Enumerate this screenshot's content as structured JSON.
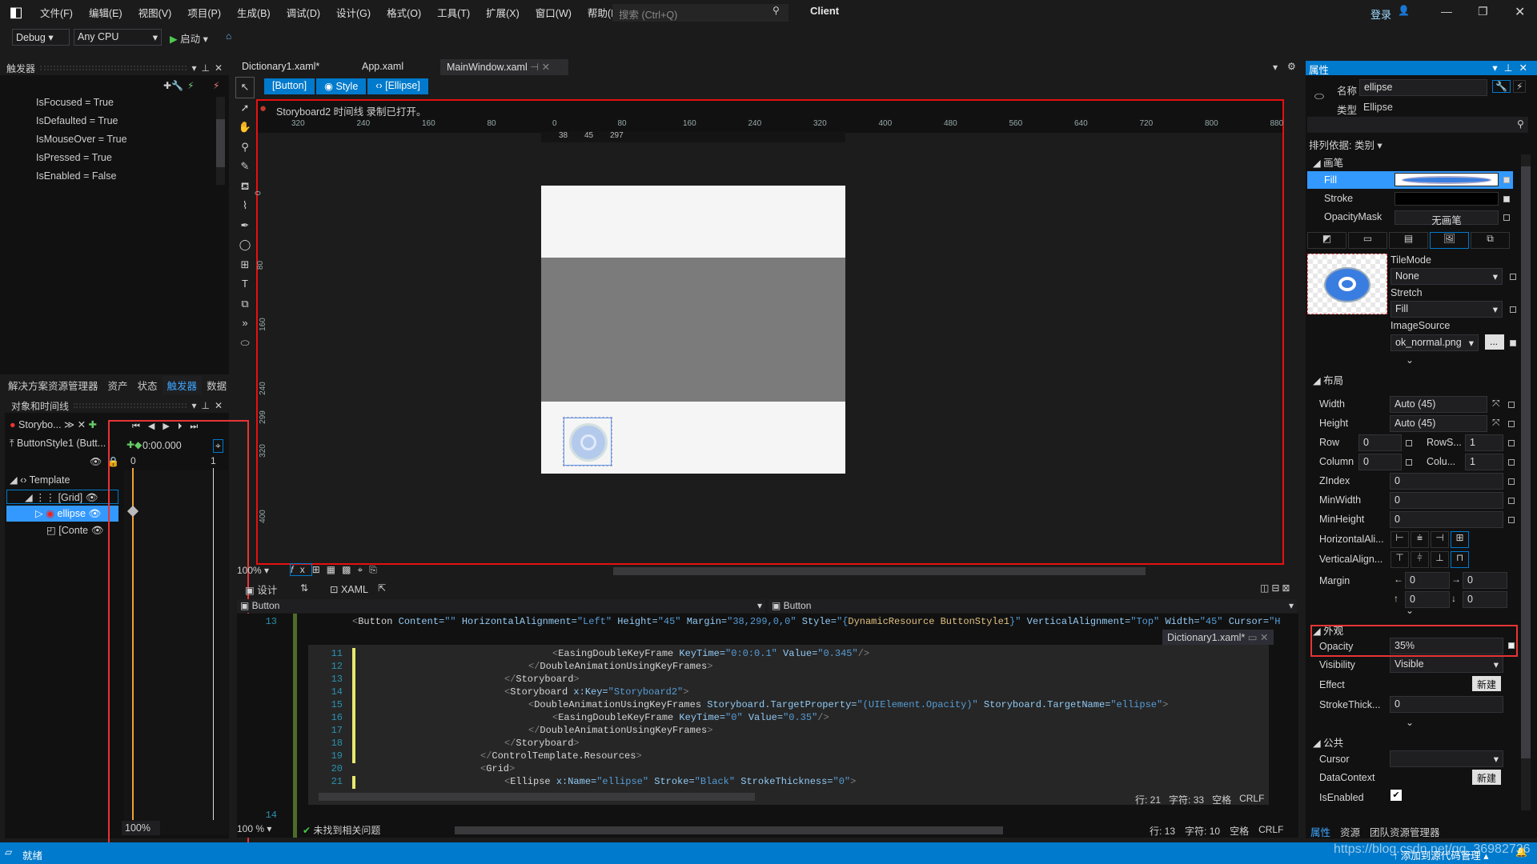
{
  "menu": {
    "items": [
      "文件(F)",
      "编辑(E)",
      "视图(V)",
      "项目(P)",
      "生成(B)",
      "调试(D)",
      "设计(G)",
      "格式(O)",
      "工具(T)",
      "扩展(X)",
      "窗口(W)",
      "帮助(H)"
    ],
    "search_placeholder": "搜索 (Ctrl+Q)",
    "solution": "Client",
    "login": "登录"
  },
  "toolbar": {
    "config": "Debug",
    "platform": "Any CPU",
    "start": "启动"
  },
  "triggers": {
    "title": "触发器",
    "items": [
      "IsFocused = True",
      "IsDefaulted = True",
      "IsMouseOver = True",
      "IsPressed = True",
      "IsEnabled = False"
    ]
  },
  "left_tabs": [
    "解决方案资源管理器",
    "资产",
    "状态",
    "触发器",
    "数据"
  ],
  "objects": {
    "title": "对象和时间线",
    "storyboard": "Storybo...",
    "root": "ButtonStyle1 (Butt...",
    "time": "0:00.000",
    "tick0": "0",
    "tick1": "1",
    "tree": [
      "Template",
      "[Grid]",
      "ellipse",
      "[Conte"
    ],
    "zoom": "100%"
  },
  "doc_tabs": [
    "Dictionary1.xaml*",
    "App.xaml",
    "MainWindow.xaml"
  ],
  "breadcrumb": [
    "[Button]",
    "Style",
    "[Ellipse]"
  ],
  "designer": {
    "recording": "Storyboard2 时间线 录制已打开。",
    "ruler": [
      "320",
      "240",
      "160",
      "80",
      "0",
      "80",
      "160",
      "240",
      "320",
      "400",
      "480",
      "560",
      "640",
      "720",
      "800",
      "880"
    ],
    "vruler": [
      "0",
      "80",
      "160",
      "240",
      "299",
      "320",
      "400"
    ],
    "margin_marks": [
      "38",
      "45",
      "297"
    ],
    "zoom": "100%"
  },
  "view_tabs": {
    "design": "设计",
    "xaml": "XAML",
    "left_combo": "Button",
    "right_combo": "Button"
  },
  "code_main": {
    "line13_no": "13",
    "line14_no": "14",
    "line13": [
      [
        "tg",
        "<"
      ],
      [
        "el",
        "Button"
      ],
      [
        "at",
        " Content="
      ],
      [
        "vl",
        "\"\""
      ],
      [
        "at",
        " HorizontalAlignment="
      ],
      [
        "vl",
        "\"Left\""
      ],
      [
        "at",
        " Height="
      ],
      [
        "vl",
        "\"45\""
      ],
      [
        "at",
        " Margin="
      ],
      [
        "vl",
        "\"38,299,0,0\""
      ],
      [
        "at",
        " Style="
      ],
      [
        "vl",
        "\"{"
      ],
      [
        "mk",
        "DynamicResource ButtonStyle1"
      ],
      [
        "vl",
        "}\""
      ],
      [
        "at",
        " VerticalAlignment="
      ],
      [
        "vl",
        "\"Top\""
      ],
      [
        "at",
        " Width="
      ],
      [
        "vl",
        "\"45\""
      ],
      [
        "at",
        " Cursor="
      ],
      [
        "vl",
        "\"Hand\""
      ],
      [
        "tg",
        "/"
      ]
    ]
  },
  "peek": {
    "tab": "Dictionary1.xaml*",
    "lines": [
      {
        "n": "11",
        "indent": 10,
        "t": [
          [
            "tg",
            "<"
          ],
          [
            "el",
            "EasingDoubleKeyFrame"
          ],
          [
            "at",
            " KeyTime="
          ],
          [
            "vl",
            "\"0:0:0.1\""
          ],
          [
            "at",
            " Value="
          ],
          [
            "vl",
            "\"0.345\""
          ],
          [
            "tg",
            "/>"
          ]
        ]
      },
      {
        "n": "12",
        "indent": 8,
        "t": [
          [
            "tg",
            "</"
          ],
          [
            "el",
            "DoubleAnimationUsingKeyFrames"
          ],
          [
            "tg",
            ">"
          ]
        ]
      },
      {
        "n": "13",
        "indent": 6,
        "t": [
          [
            "tg",
            "</"
          ],
          [
            "el",
            "Storyboard"
          ],
          [
            "tg",
            ">"
          ]
        ]
      },
      {
        "n": "14",
        "indent": 6,
        "t": [
          [
            "tg",
            "<"
          ],
          [
            "el",
            "Storyboard"
          ],
          [
            "at",
            " x:Key="
          ],
          [
            "vl",
            "\"Storyboard2\""
          ],
          [
            "tg",
            ">"
          ]
        ]
      },
      {
        "n": "15",
        "indent": 8,
        "t": [
          [
            "tg",
            "<"
          ],
          [
            "el",
            "DoubleAnimationUsingKeyFrames"
          ],
          [
            "at",
            " Storyboard.TargetProperty="
          ],
          [
            "vl",
            "\"(UIElement.Opacity)\""
          ],
          [
            "at",
            " Storyboard.TargetName="
          ],
          [
            "vl",
            "\"ellipse\""
          ],
          [
            "tg",
            ">"
          ]
        ]
      },
      {
        "n": "16",
        "indent": 10,
        "t": [
          [
            "tg",
            "<"
          ],
          [
            "el",
            "EasingDoubleKeyFrame"
          ],
          [
            "at",
            " KeyTime="
          ],
          [
            "vl",
            "\"0\""
          ],
          [
            "at",
            " Value="
          ],
          [
            "vl",
            "\"0.35\""
          ],
          [
            "tg",
            "/>"
          ]
        ]
      },
      {
        "n": "17",
        "indent": 8,
        "t": [
          [
            "tg",
            "</"
          ],
          [
            "el",
            "DoubleAnimationUsingKeyFrames"
          ],
          [
            "tg",
            ">"
          ]
        ]
      },
      {
        "n": "18",
        "indent": 6,
        "t": [
          [
            "tg",
            "</"
          ],
          [
            "el",
            "Storyboard"
          ],
          [
            "tg",
            ">"
          ]
        ]
      },
      {
        "n": "19",
        "indent": 4,
        "t": [
          [
            "tg",
            "</"
          ],
          [
            "el",
            "ControlTemplate.Resources"
          ],
          [
            "tg",
            ">"
          ]
        ]
      },
      {
        "n": "20",
        "indent": 4,
        "t": [
          [
            "tg",
            "<"
          ],
          [
            "el",
            "Grid"
          ],
          [
            "tg",
            ">"
          ]
        ]
      },
      {
        "n": "21",
        "indent": 6,
        "t": [
          [
            "tg",
            "<"
          ],
          [
            "el",
            "Ellipse"
          ],
          [
            "at",
            " x:Name="
          ],
          [
            "vl",
            "\"ellipse\""
          ],
          [
            "at",
            " Stroke="
          ],
          [
            "vl",
            "\"Black\""
          ],
          [
            "at",
            " StrokeThickness="
          ],
          [
            "vl",
            "\"0\""
          ],
          [
            "tg",
            ">"
          ]
        ]
      }
    ],
    "status": {
      "line": "行: 21",
      "col": "字符: 33",
      "space": "空格",
      "eol": "CRLF"
    }
  },
  "editor_status": {
    "zoom": "100 %",
    "issues": "未找到相关问题",
    "line": "行: 13",
    "col": "字符: 10",
    "space": "空格",
    "eol": "CRLF"
  },
  "properties": {
    "title": "属性",
    "name_label": "名称",
    "name_value": "ellipse",
    "type_label": "类型",
    "type_value": "Ellipse",
    "sort": "排列依据: 类别",
    "brush": {
      "section": "画笔",
      "fill": "Fill",
      "stroke": "Stroke",
      "opacity_mask": "OpacityMask",
      "no_brush": "无画笔",
      "tilemode_label": "TileMode",
      "tilemode": "None",
      "stretch_label": "Stretch",
      "stretch": "Fill",
      "imagesource_label": "ImageSource",
      "imagesource": "ok_normal.png",
      "browse": "..."
    },
    "layout": {
      "section": "布局",
      "width_label": "Width",
      "width": "Auto (45)",
      "height_label": "Height",
      "height": "Auto (45)",
      "row_label": "Row",
      "row": "0",
      "rowspan_label": "RowS...",
      "rowspan": "1",
      "column_label": "Column",
      "column": "0",
      "colspan_label": "Colu...",
      "colspan": "1",
      "zindex_label": "ZIndex",
      "zindex": "0",
      "minwidth_label": "MinWidth",
      "minwidth": "0",
      "minheight_label": "MinHeight",
      "minheight": "0",
      "halign_label": "HorizontalAli...",
      "valign_label": "VerticalAlign...",
      "margin_label": "Margin",
      "margin": [
        "0",
        "0",
        "0",
        "0"
      ]
    },
    "appearance": {
      "section": "外观",
      "opacity_label": "Opacity",
      "opacity": "35%",
      "visibility_label": "Visibility",
      "visibility": "Visible",
      "effect_label": "Effect",
      "new": "新建",
      "strokethick_label": "StrokeThick...",
      "strokethick": "0"
    },
    "common": {
      "section": "公共",
      "cursor_label": "Cursor",
      "cursor": "",
      "datacontext_label": "DataContext",
      "new": "新建",
      "isenabled_label": "IsEnabled",
      "isenabled": true
    },
    "tabs": [
      "属性",
      "资源",
      "团队资源管理器"
    ]
  },
  "statusbar": {
    "ready": "就绪",
    "source_control": "添加到源代码管理",
    "watermark": "https://blog.csdn.net/qq_36982736"
  },
  "colors": {
    "accent": "#007acc",
    "annotation": "#e83434",
    "recording": "#c0392b"
  }
}
